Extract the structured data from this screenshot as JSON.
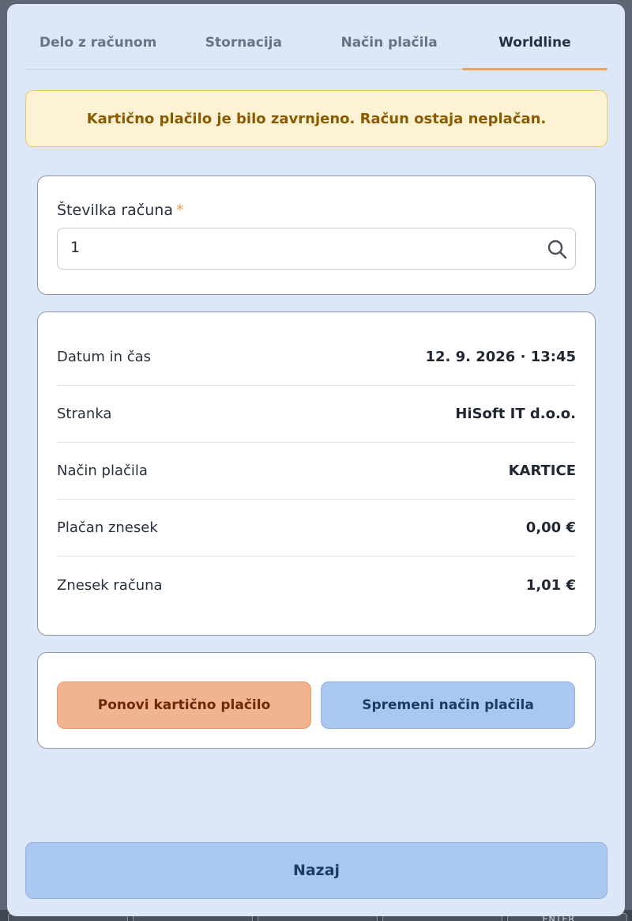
{
  "tabs": [
    {
      "label": "Delo z računom",
      "active": false
    },
    {
      "label": "Stornacija",
      "active": false
    },
    {
      "label": "Način plačila",
      "active": false
    },
    {
      "label": "Worldline",
      "active": true
    }
  ],
  "alert": {
    "message": "Kartično plačilo je bilo zavrnjeno. Račun ostaja neplačan."
  },
  "invoice_field": {
    "label": "Številka računa",
    "required_mark": "*",
    "value": "1",
    "icon": "search-icon"
  },
  "details": [
    {
      "label": "Datum in čas",
      "value": "12. 9. 2026 · 13:45"
    },
    {
      "label": "Stranka",
      "value": "HiSoft IT d.o.o."
    },
    {
      "label": "Način plačila",
      "value": "KARTICE"
    },
    {
      "label": "Plačan znesek",
      "value": "0,00 €"
    },
    {
      "label": "Znesek računa",
      "value": "1,01 €"
    }
  ],
  "actions": {
    "retry_label": "Ponovi kartično plačilo",
    "change_label": "Spremeni način plačila",
    "back_label": "Nazaj"
  },
  "backdrop": {
    "key_label": "ENTER"
  },
  "colors": {
    "accent_tab": "#f0a060",
    "alert_bg": "#fdf3d4",
    "alert_text": "#8a5a00",
    "retry_bg": "#f2b48e",
    "primary_bg": "#aac8ef",
    "modal_bg": "#dce8f8"
  }
}
